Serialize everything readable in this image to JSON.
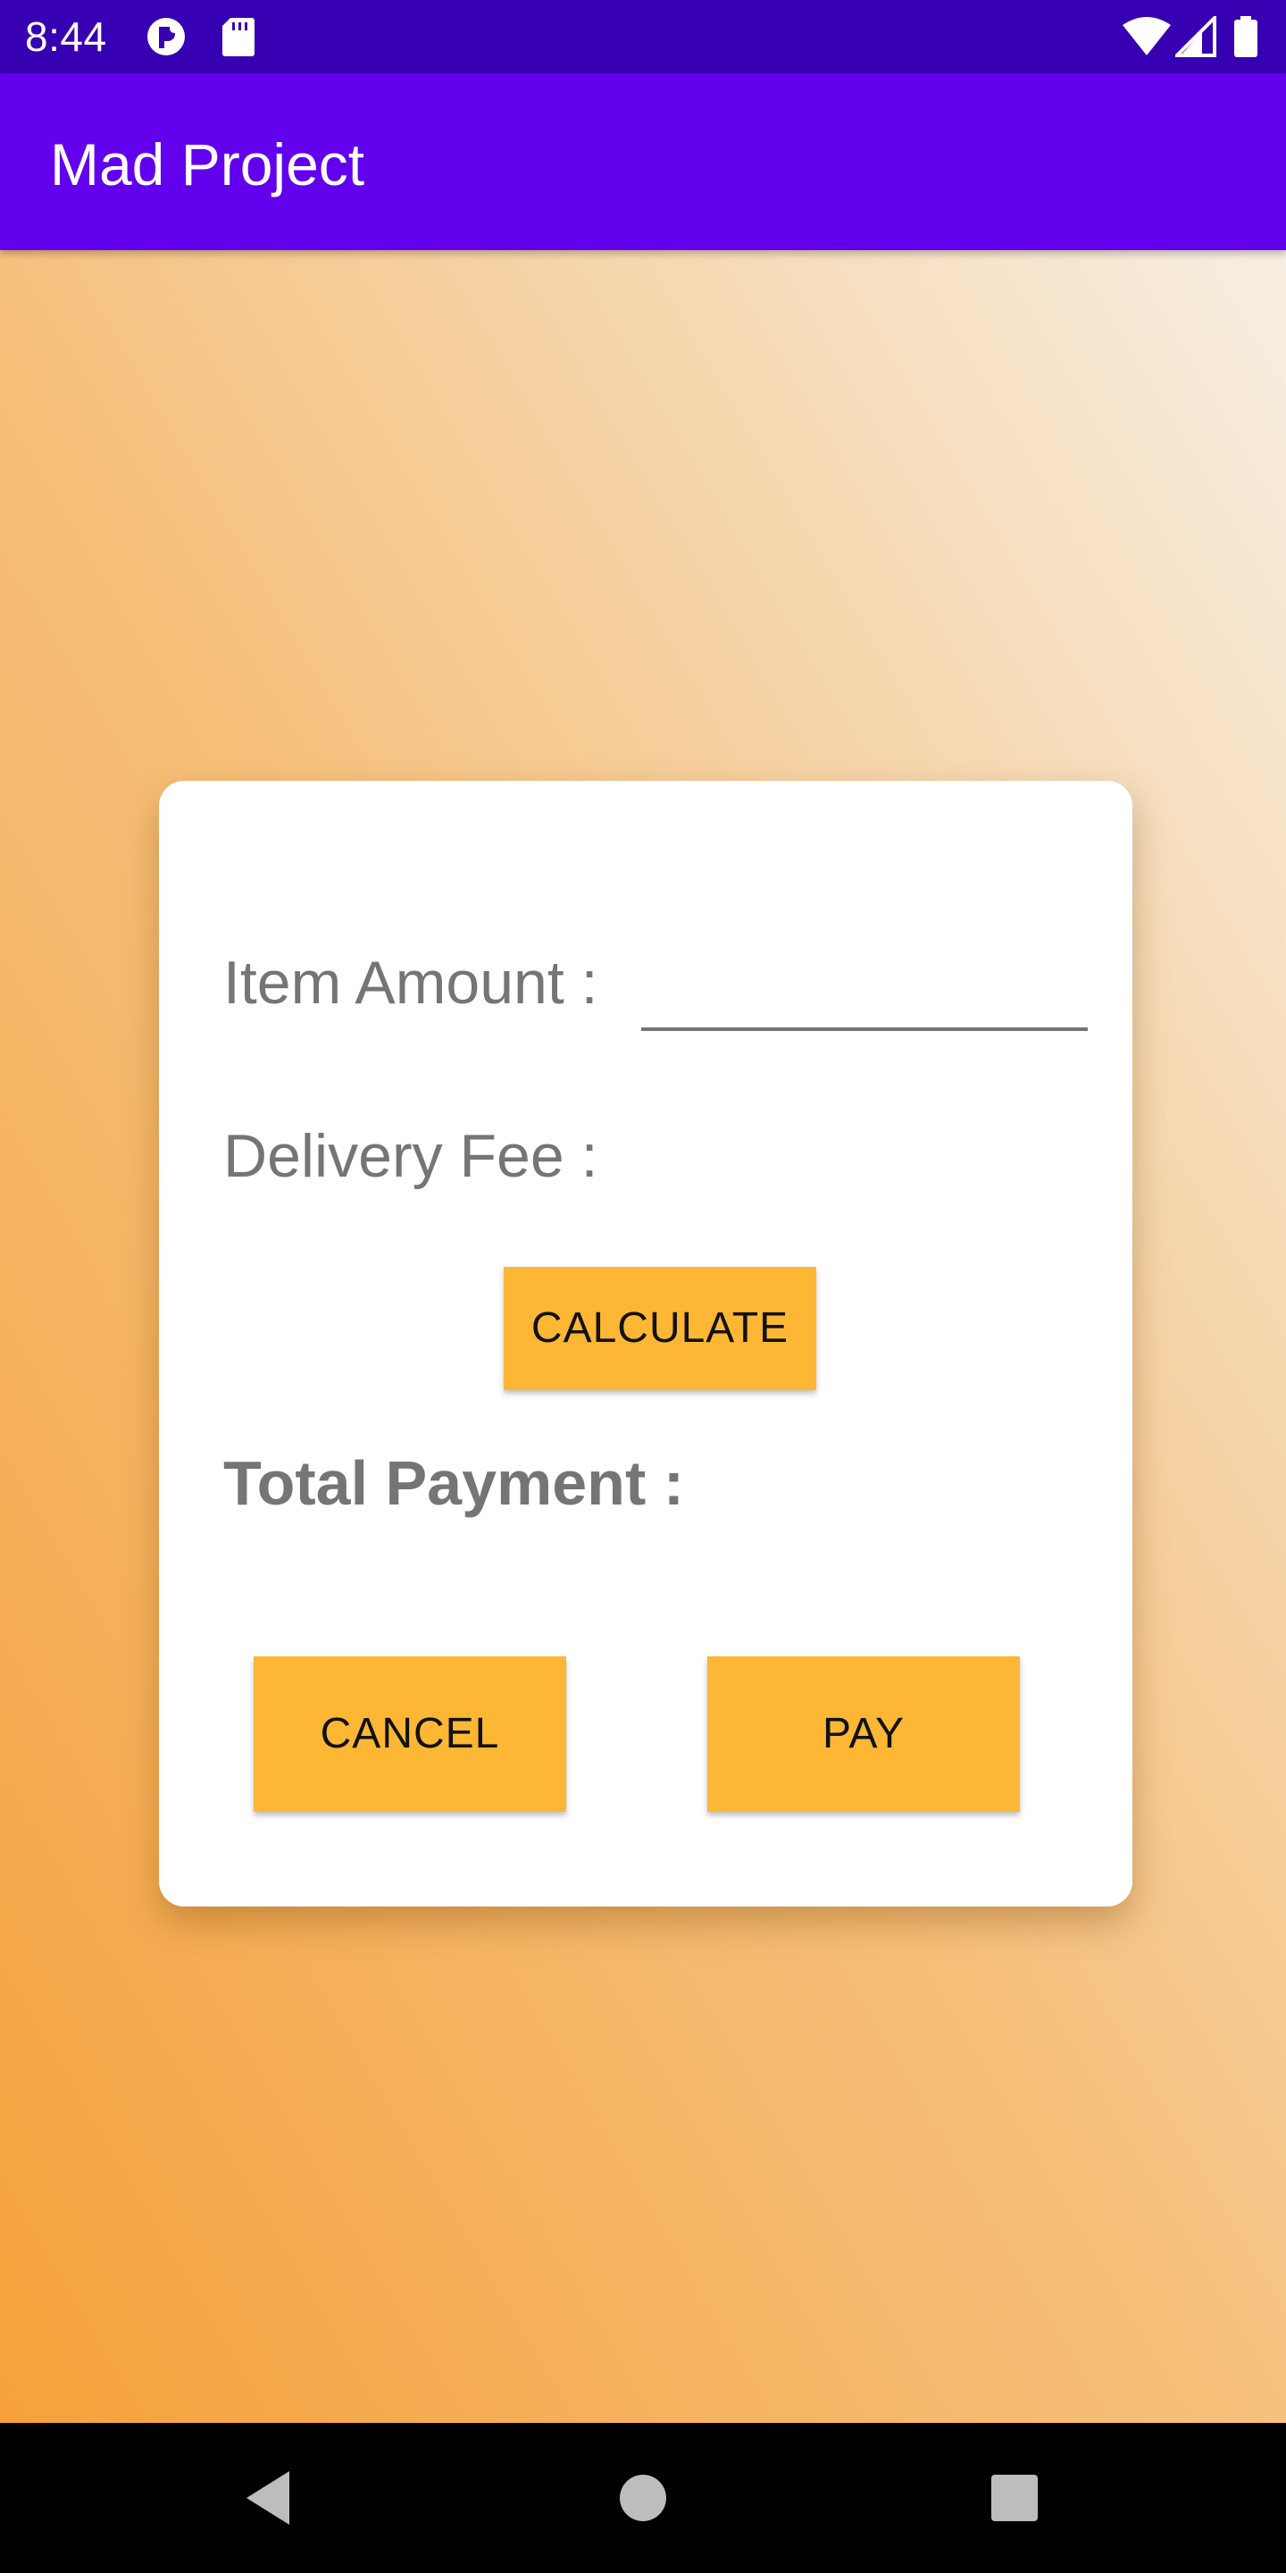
{
  "status_bar": {
    "time": "8:44",
    "icons_left": [
      "privacy-icon",
      "sd-card-icon"
    ],
    "icons_right": [
      "wifi-icon",
      "cell-signal-icon",
      "battery-icon"
    ]
  },
  "app_bar": {
    "title": "Mad Project"
  },
  "form": {
    "item_amount_label": "Item Amount :",
    "item_amount_value": "",
    "delivery_fee_label": "Delivery Fee :",
    "calculate_label": "CALCULATE",
    "total_payment_label": "Total Payment :",
    "cancel_label": "CANCEL",
    "pay_label": "PAY"
  },
  "colors": {
    "status_bar": "#3700b3",
    "app_bar": "#6200ee",
    "button": "#fdb734",
    "label_text": "#757575",
    "gradient_bottom_left": "#f6a13b",
    "gradient_top_right": "#f7efe3"
  },
  "navigation": {
    "buttons": [
      "back-icon",
      "home-icon",
      "recents-icon"
    ]
  }
}
